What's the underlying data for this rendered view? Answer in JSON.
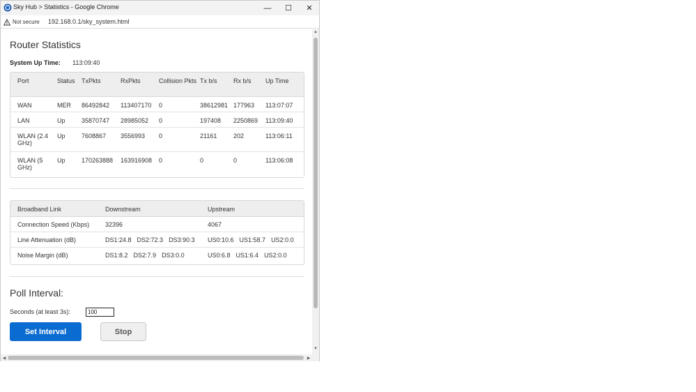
{
  "window": {
    "title": "Sky Hub > Statistics - Google Chrome",
    "minimize_glyph": "—",
    "maximize_glyph": "☐",
    "close_glyph": "✕"
  },
  "address_bar": {
    "security_label": "Not secure",
    "url": "192.168.0.1/sky_system.html"
  },
  "page": {
    "title": "Router Statistics",
    "uptime_label": "System Up Time:",
    "uptime_value": "113:09:40"
  },
  "port_table": {
    "headers": [
      "Port",
      "Status",
      "TxPkts",
      "RxPkts",
      "Collision Pkts",
      "Tx b/s",
      "Rx b/s",
      "Up Time"
    ],
    "rows": [
      [
        "WAN",
        "MER",
        "86492842",
        "113407170",
        "0",
        "38612981",
        "177963",
        "113:07:07"
      ],
      [
        "LAN",
        "Up",
        "35870747",
        "28985052",
        "0",
        "197408",
        "2250869",
        "113:09:40"
      ],
      [
        "WLAN (2.4 GHz)",
        "Up",
        "7608867",
        "3556993",
        "0",
        "21161",
        "202",
        "113:06:11"
      ],
      [
        "WLAN (5 GHz)",
        "Up",
        "170263888",
        "163916908",
        "0",
        "0",
        "0",
        "113:06:08"
      ]
    ]
  },
  "broadband_table": {
    "headers": [
      "Broadband Link",
      "Downstream",
      "Upstream"
    ],
    "rows": [
      {
        "label": "Connection Speed (Kbps)",
        "down": [
          "32396"
        ],
        "up": [
          "4067"
        ]
      },
      {
        "label": "Line Attenuation (dB)",
        "down": [
          "DS1:24.8",
          "DS2:72.3",
          "DS3:90.3"
        ],
        "up": [
          "US0:10.6",
          "US1:58.7",
          "US2:0.0"
        ]
      },
      {
        "label": "Noise Margin (dB)",
        "down": [
          "DS1:8.2",
          "DS2:7.9",
          "DS3:0.0"
        ],
        "up": [
          "US0:6.8",
          "US1:6.4",
          "US2:0.0"
        ]
      }
    ]
  },
  "poll": {
    "title": "Poll Interval:",
    "seconds_label": "Seconds (at least 3s):",
    "seconds_value": "100",
    "set_button": "Set Interval",
    "stop_button": "Stop"
  },
  "colors": {
    "primary_button": "#0a6bd0",
    "table_header_bg": "#eeeeee"
  }
}
